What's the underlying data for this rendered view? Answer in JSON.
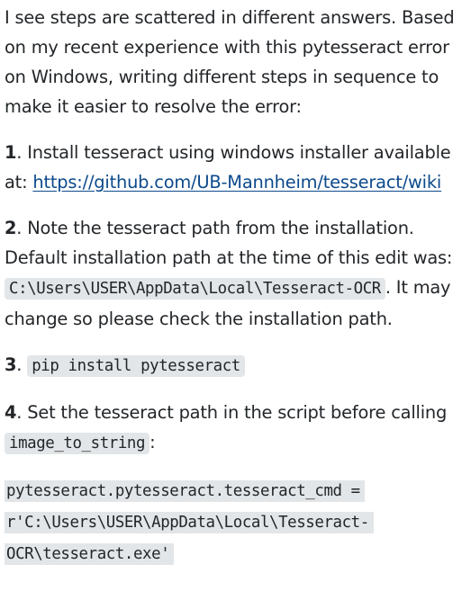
{
  "intro": "I see steps are scattered in different answers. Based on my recent experience with this pytesseract error on Windows, writing different steps in sequence to make it easier to resolve the error:",
  "step1": {
    "num": "1",
    "text": ". Install tesseract using windows installer available at: ",
    "link": "https://github.com/UB-Mannheim/tesseract/wiki"
  },
  "step2": {
    "num": "2",
    "text": ". Note the tesseract path from the installation. Default installation path at the time of this edit was: ",
    "code": "C:\\Users\\USER\\AppData\\Local\\Tesseract-OCR",
    "after": ". It may change so please check the installation path."
  },
  "step3": {
    "num": "3",
    "sep": ". ",
    "code": "pip install pytesseract"
  },
  "step4": {
    "num": "4",
    "text": ". Set the tesseract path in the script before calling ",
    "code": "image_to_string",
    "after": ":"
  },
  "code_block": {
    "line1": "pytesseract.pytesseract.tesseract_cmd = ",
    "line2": "r'C:\\Users\\USER\\AppData\\Local\\Tesseract-",
    "line3": "OCR\\tesseract.exe'"
  }
}
